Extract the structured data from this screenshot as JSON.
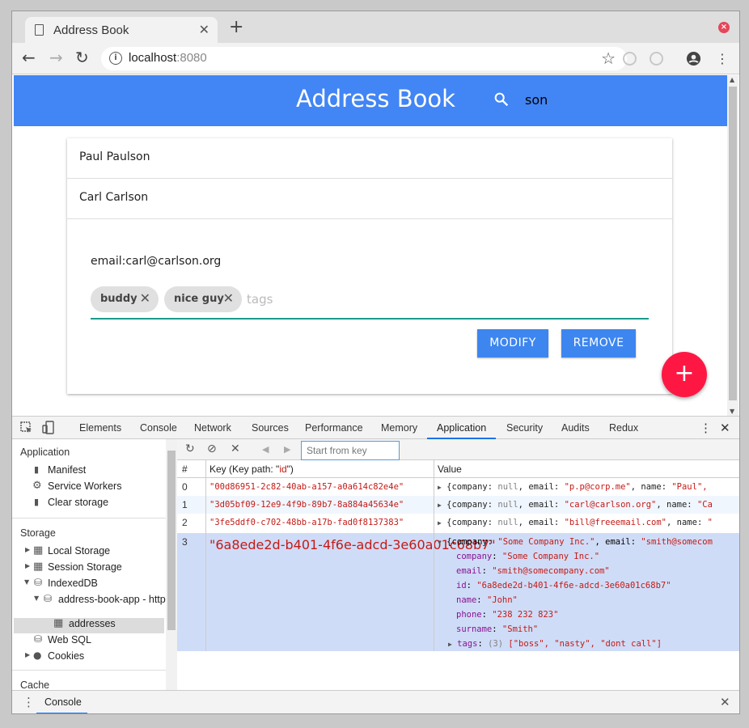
{
  "browser": {
    "tab_title": "Address Book",
    "url_host": "localhost",
    "url_port": ":8080"
  },
  "app": {
    "title": "Address Book",
    "search_value": "son",
    "contacts": [
      "Paul Paulson",
      "Carl Carlson"
    ],
    "detail": {
      "email": "email:carl@carlson.org",
      "tags": [
        "buddy",
        "nice guy"
      ],
      "tags_placeholder": "tags",
      "modify_label": "MODIFY",
      "remove_label": "REMOVE"
    },
    "fab_label": "+"
  },
  "devtools": {
    "tabs": [
      "Elements",
      "Console",
      "Network",
      "Sources",
      "Performance",
      "Memory",
      "Application",
      "Security",
      "Audits",
      "Redux"
    ],
    "active_tab": "Application",
    "sidebar": {
      "application_header": "Application",
      "application_items": [
        "Manifest",
        "Service Workers",
        "Clear storage"
      ],
      "storage_header": "Storage",
      "local_storage": "Local Storage",
      "session_storage": "Session Storage",
      "indexeddb": "IndexedDB",
      "db_name": "address-book-app - http:",
      "store_name": "addresses",
      "web_sql": "Web SQL",
      "cookies": "Cookies",
      "cache_header": "Cache"
    },
    "start_from_key_placeholder": "Start from key",
    "table": {
      "col_index": "#",
      "col_key_prefix": "Key (Key path: \"",
      "col_key_path": "id",
      "col_key_suffix": "\")",
      "col_value": "Value",
      "rows": [
        {
          "index": "0",
          "key": "\"00d86951-2c82-40ab-a157-a0a614c82e4e\"",
          "email": "\"p.p@corp.me\"",
          "name": "\"Paul\","
        },
        {
          "index": "1",
          "key": "\"3d05bf09-12e9-4f9b-89b7-8a884a45634e\"",
          "email": "\"carl@carlson.org\"",
          "name": "\"Ca"
        },
        {
          "index": "2",
          "key": "\"3fe5ddf0-c702-48bb-a17b-fad0f8137383\"",
          "email": "\"bill@freeemail.com\"",
          "name": "\""
        },
        {
          "index": "3",
          "key": "\"6a8ede2d-b401-4f6e-adcd-3e60a01c68b7\""
        }
      ],
      "expanded": {
        "summary_company": "\"Some Company Inc.\"",
        "summary_email": "\"smith@somecom",
        "company": "\"Some Company Inc.\"",
        "email": "\"smith@somecompany.com\"",
        "id": "\"6a8ede2d-b401-4f6e-adcd-3e60a01c68b7\"",
        "name": "\"John\"",
        "phone": "\"238 232 823\"",
        "surname": "\"Smith\"",
        "tags_count": "(3)",
        "tags": "[\"boss\", \"nasty\", \"dont call\"]"
      }
    },
    "drawer_tab": "Console"
  }
}
